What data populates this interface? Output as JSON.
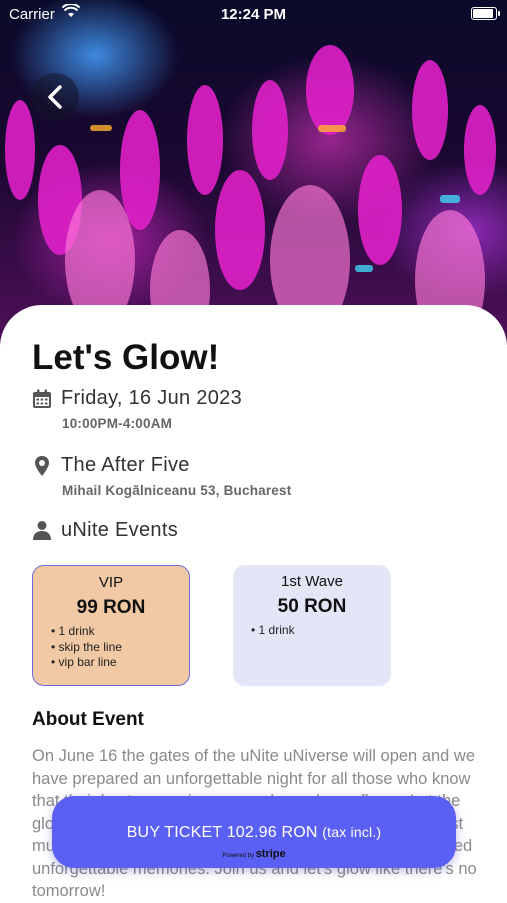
{
  "status_bar": {
    "carrier": "Carrier",
    "time": "12:24 PM"
  },
  "hero": {
    "image": "concert crowd raising hands under neon lights"
  },
  "event": {
    "title": "Let's Glow!",
    "date": "Friday, 16 Jun 2023",
    "time_range": "10:00PM-4:00AM",
    "venue": "The After Five",
    "address": "Mihail Kogălniceanu 53, Bucharest",
    "organizer": "uNite Events"
  },
  "tickets": [
    {
      "name": "VIP",
      "price": "99 RON",
      "perks": [
        "1 drink",
        "skip the line",
        "vip bar line"
      ],
      "selected": true,
      "color": "#f1c9a4"
    },
    {
      "name": "1st Wave",
      "price": "50 RON",
      "perks": [
        "1 drink"
      ],
      "selected": false,
      "color": "#e4e5f6"
    }
  ],
  "about": {
    "heading": "About Event",
    "body": "On June 16 the gates of the uNite uNiverse will open and we have prepared an unforgettable night for all those who know that their best memories are made on dance floors. Let the glow paint you and enjoy a night like no other, with the best music and lights, together with your friends. It will be flooded unforgettable memories. Join us and let's glow like there's no tomorrow!"
  },
  "buy_button": {
    "label": "BUY TICKET 102.96 RON",
    "suffix": "(tax incl.)",
    "powered_prefix": "Powered by",
    "powered_brand": "stripe",
    "color": "#5b60f4"
  },
  "icons": {
    "back": "chevron-left-icon",
    "calendar": "calendar-icon",
    "location": "map-pin-icon",
    "organizer": "person-icon",
    "wifi": "wifi-icon",
    "battery": "battery-icon"
  }
}
